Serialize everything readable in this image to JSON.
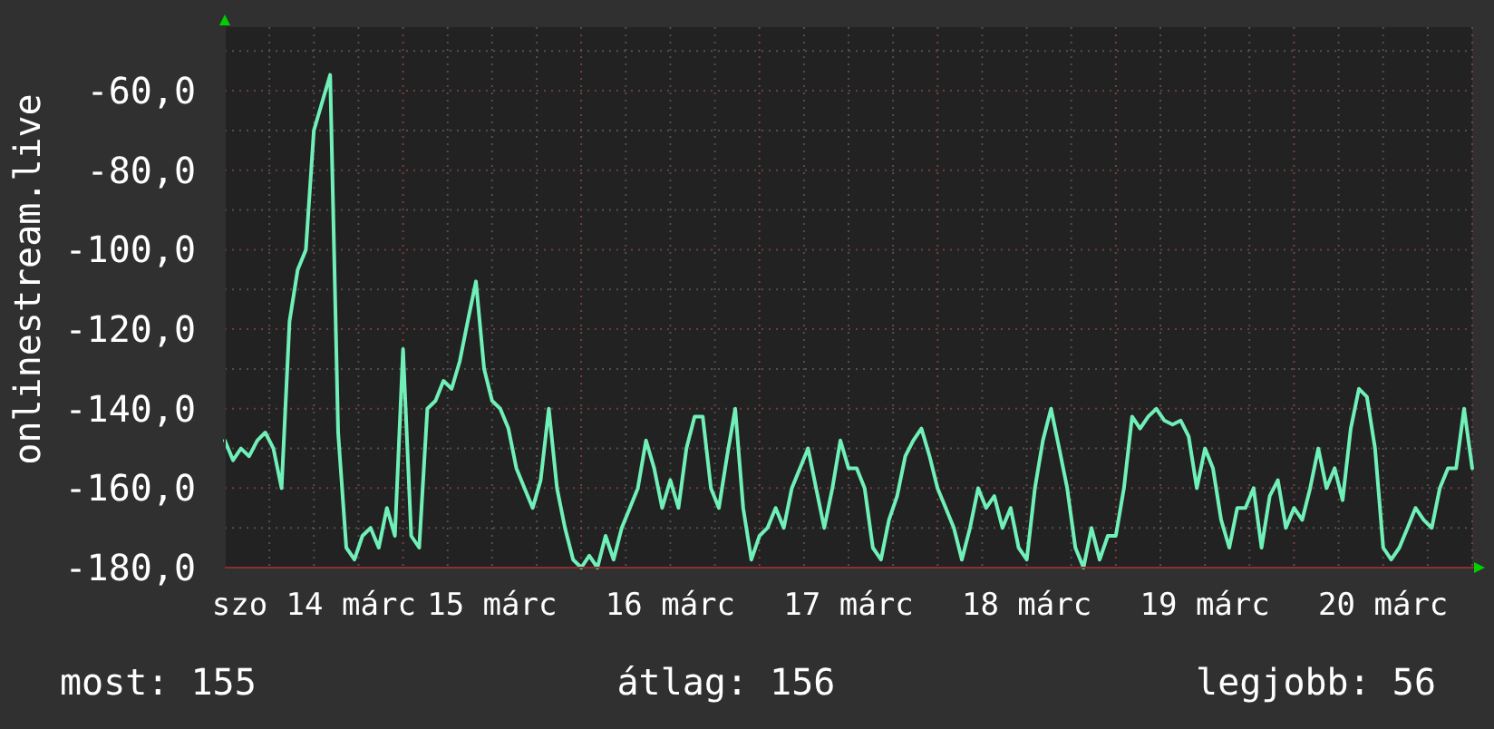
{
  "graph": {
    "x_labels": [
      "szo 14 márc",
      "15 márc",
      "16 márc",
      "17 márc",
      "18 márc",
      "19 márc",
      "20 márc"
    ],
    "chart_data": {
      "type": "line",
      "ylabel": "onlinestream.live",
      "grid": true,
      "ylim": [
        -180,
        -44
      ],
      "yticks": [
        {
          "value": -60,
          "label": "-60,0"
        },
        {
          "value": -80,
          "label": "-80,0"
        },
        {
          "value": -100,
          "label": "-100,0"
        },
        {
          "value": -120,
          "label": "-120,0"
        },
        {
          "value": -140,
          "label": "-140,0"
        },
        {
          "value": -160,
          "label": "-160,0"
        },
        {
          "value": -180,
          "label": "-180,0"
        }
      ],
      "series": [
        {
          "color": "#70f0b8",
          "values": [
            -148,
            -153,
            -150,
            -152,
            -148,
            -146,
            -150,
            -160,
            -118,
            -105,
            -100,
            -70,
            -63,
            -56,
            -146,
            -175,
            -178,
            -172,
            -170,
            -175,
            -165,
            -172,
            -125,
            -172,
            -175,
            -140,
            -138,
            -133,
            -135,
            -128,
            -118,
            -108,
            -130,
            -138,
            -140,
            -145,
            -155,
            -160,
            -165,
            -158,
            -140,
            -160,
            -170,
            -178,
            -180,
            -177,
            -180,
            -172,
            -178,
            -170,
            -165,
            -160,
            -148,
            -155,
            -165,
            -158,
            -165,
            -150,
            -142,
            -142,
            -160,
            -165,
            -152,
            -140,
            -165,
            -178,
            -172,
            -170,
            -165,
            -170,
            -160,
            -155,
            -150,
            -160,
            -170,
            -160,
            -148,
            -155,
            -155,
            -160,
            -175,
            -178,
            -168,
            -162,
            -152,
            -148,
            -145,
            -152,
            -160,
            -165,
            -170,
            -178,
            -170,
            -160,
            -165,
            -162,
            -170,
            -165,
            -175,
            -178,
            -160,
            -148,
            -140,
            -150,
            -160,
            -175,
            -180,
            -170,
            -178,
            -172,
            -172,
            -160,
            -142,
            -145,
            -142,
            -140,
            -143,
            -144,
            -143,
            -147,
            -160,
            -150,
            -155,
            -168,
            -175,
            -165,
            -165,
            -160,
            -175,
            -162,
            -158,
            -170,
            -165,
            -168,
            -160,
            -150,
            -160,
            -155,
            -163,
            -145,
            -135,
            -137,
            -150,
            -175,
            -178,
            -175,
            -170,
            -165,
            -168,
            -170,
            -160,
            -155,
            -155,
            -140,
            -155
          ]
        }
      ]
    }
  },
  "legend": [
    {
      "label": "most: 155"
    },
    {
      "label": "átlag: 156"
    },
    {
      "label": "legjobb: 56"
    }
  ]
}
